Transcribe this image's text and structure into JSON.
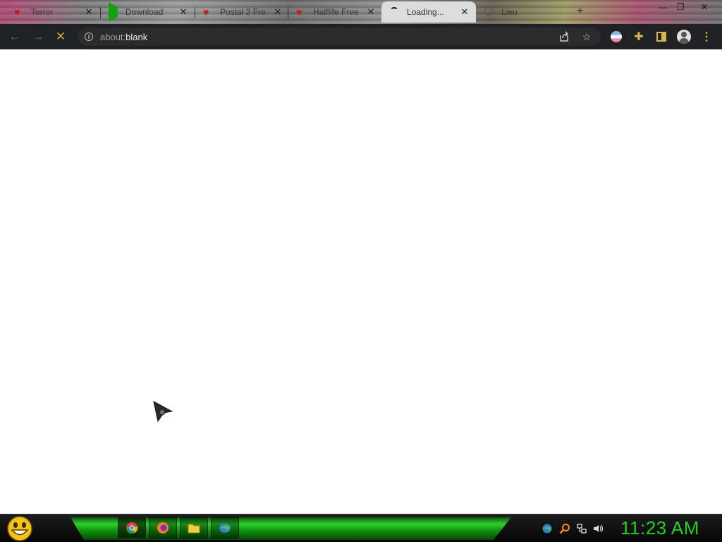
{
  "browser": {
    "tabs": [
      {
        "title": "Terror",
        "favicon": "red-heart-icon",
        "active": false
      },
      {
        "title": "Download",
        "favicon": "green-play-icon",
        "active": false
      },
      {
        "title": "Postal 2 Fre",
        "favicon": "red-heart-icon",
        "active": false
      },
      {
        "title": "Halflife Free",
        "favicon": "red-heart-icon",
        "active": false
      },
      {
        "title": "Loading...",
        "favicon": "loading-spinner-icon",
        "active": true
      },
      {
        "title": "Lieu",
        "favicon": "globe-icon",
        "active": false
      }
    ],
    "new_tab_label": "+",
    "address_bar": {
      "scheme": "about:",
      "host": "blank"
    },
    "toolbar_icons": [
      "back-icon",
      "forward-icon",
      "stop-icon",
      "share-icon",
      "bookmark-star-icon",
      "flag-extension-icon",
      "puzzle-extension-icon",
      "side-panel-icon",
      "profile-avatar-icon",
      "menu-icon"
    ]
  },
  "taskbar": {
    "start_icon": "smiley-start-icon",
    "pinned": [
      "chrome-icon",
      "firefox-icon",
      "folder-icon",
      "globe-app-icon"
    ],
    "tray": [
      "network-globe-icon",
      "search-icon",
      "network-icon",
      "volume-icon"
    ],
    "clock": "11:23 AM"
  },
  "colors": {
    "toolbar_bg": "#202124",
    "accent_gold": "#d8b74a",
    "clock_green": "#21d021",
    "taskbar_green": "#2fd12f"
  }
}
